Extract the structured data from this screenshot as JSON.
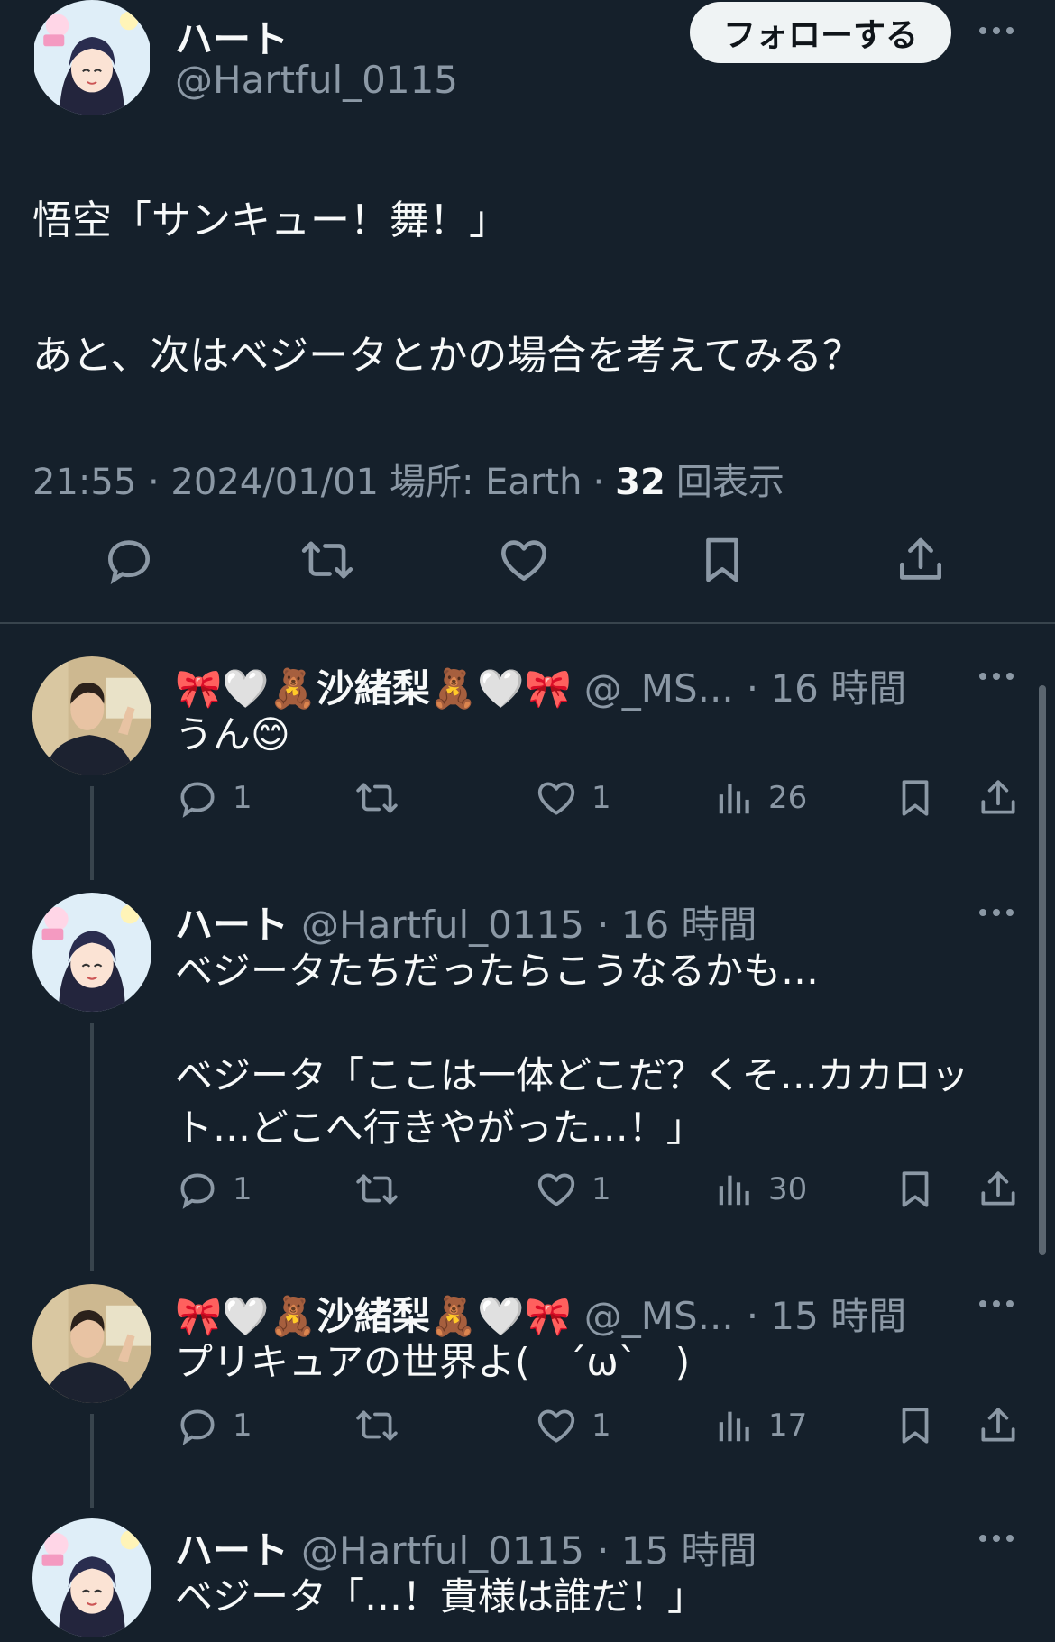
{
  "main_tweet": {
    "display_name": "ハート",
    "handle": "@Hartful_0115",
    "follow_label": "フォローする",
    "text_line1": "悟空「サンキュー！舞！」",
    "text_line2": "あと、次はベジータとかの場合を考えてみる？",
    "time": "21:55 · 2024/01/01",
    "location": "場所: Earth",
    "sep": "·",
    "views_count": "32",
    "views_label": "回表示"
  },
  "replies": [
    {
      "display_name": "🎀🤍🧸沙緒梨🧸🤍🎀",
      "handle": "@_MS...",
      "time": "· 16 時間",
      "text": "うん😊",
      "reply_count": "1",
      "retweet_count": "",
      "like_count": "1",
      "view_count": "26"
    },
    {
      "display_name": "ハート",
      "handle": "@Hartful_0115",
      "time": "· 16 時間",
      "text": "ベジータたちだったらこうなるかも…\n\nベジータ「ここは一体どこだ？くそ…カカロッ\nト…どこへ行きやがった…！」",
      "reply_count": "1",
      "retweet_count": "",
      "like_count": "1",
      "view_count": "30"
    },
    {
      "display_name": "🎀🤍🧸沙緒梨🧸🤍🎀",
      "handle": "@_MS...",
      "time": "· 15 時間",
      "text": "プリキュアの世界よ(　ˊωˋ　)",
      "reply_count": "1",
      "retweet_count": "",
      "like_count": "1",
      "view_count": "17"
    },
    {
      "display_name": "ハート",
      "handle": "@Hartful_0115",
      "time": "· 15 時間",
      "text": "ベジータ「…！貴様は誰だ！」"
    }
  ],
  "icons": {
    "reply": "reply-icon",
    "retweet": "retweet-icon",
    "like": "heart-icon",
    "bookmark": "bookmark-icon",
    "share": "share-icon",
    "views": "views-icon",
    "more": "more-icon"
  },
  "colors": {
    "background": "#15202b",
    "text": "#f7f9f9",
    "muted": "#8b98a5",
    "follow_bg": "#eff3f4"
  }
}
